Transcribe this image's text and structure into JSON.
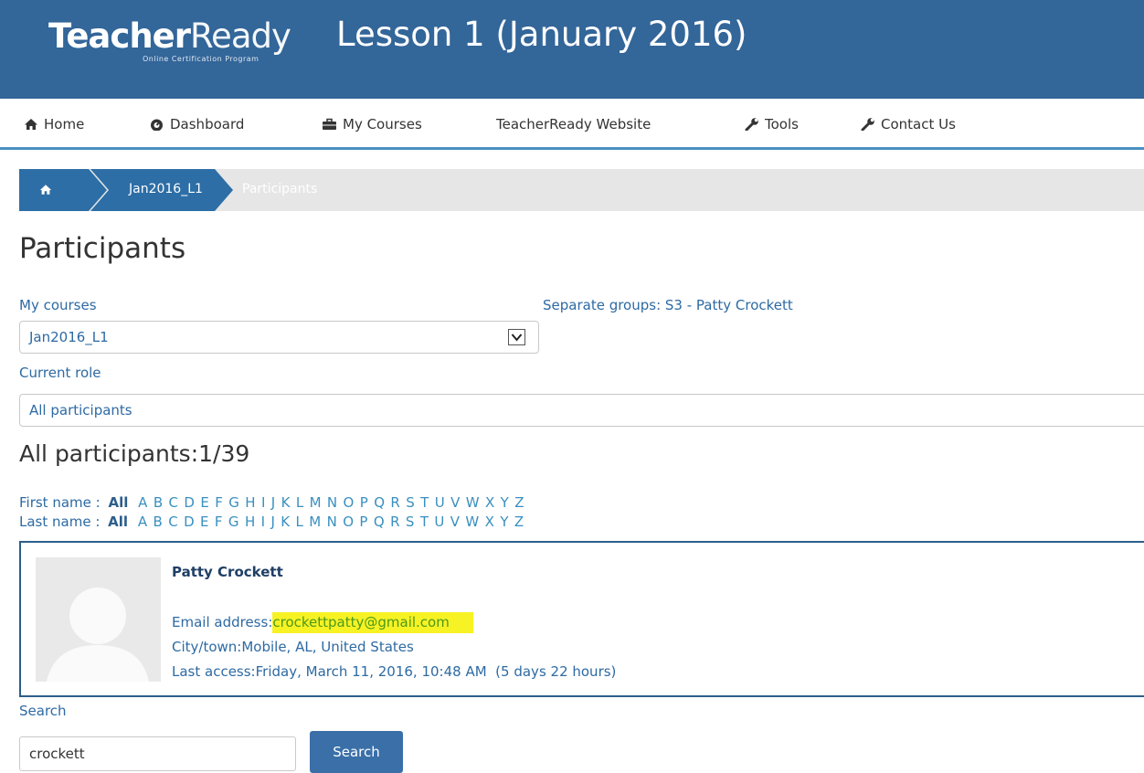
{
  "header": {
    "logo_bold": "Teacher",
    "logo_light": "Ready",
    "logo_tagline": "Online Certification Program",
    "title": "Lesson 1 (January 2016)",
    "background": "#336699"
  },
  "nav": {
    "items": [
      {
        "label": "Home",
        "icon": "home-icon"
      },
      {
        "label": "Dashboard",
        "icon": "dashboard-icon"
      },
      {
        "label": "My Courses",
        "icon": "briefcase-icon"
      },
      {
        "label": "TeacherReady Website",
        "icon": ""
      },
      {
        "label": "Tools",
        "icon": "wrench-icon"
      },
      {
        "label": "Contact Us",
        "icon": "wrench-icon"
      }
    ]
  },
  "breadcrumb": {
    "home_icon": "home-icon",
    "course": "Jan2016_L1",
    "current": "Participants"
  },
  "page": {
    "title": "Participants"
  },
  "filters": {
    "my_courses_label": "My courses",
    "my_courses_value": "Jan2016_L1",
    "groups_label": "Separate groups: S3 - Patty Crockett",
    "current_role_label": "Current role",
    "current_role_value": "All participants"
  },
  "participants": {
    "count_label": "All participants:1/39",
    "first_name_label": "First name :",
    "last_name_label": "Last name :",
    "all_label": "All",
    "letters": [
      "A",
      "B",
      "C",
      "D",
      "E",
      "F",
      "G",
      "H",
      "I",
      "J",
      "K",
      "L",
      "M",
      "N",
      "O",
      "P",
      "Q",
      "R",
      "S",
      "T",
      "U",
      "V",
      "W",
      "X",
      "Y",
      "Z"
    ]
  },
  "user": {
    "name": "Patty Crockett",
    "email_label": "Email address:",
    "email": "crockettpatty@gmail.com",
    "city_label": "City/town:",
    "city": "Mobile, AL, United States",
    "last_access_label": "Last access:",
    "last_access": "Friday, March 11, 2016, 10:48 AM  (5 days 22 hours)",
    "highlight_color": "#f7f224"
  },
  "search": {
    "label": "Search",
    "value": "crockett",
    "button": "Search"
  }
}
